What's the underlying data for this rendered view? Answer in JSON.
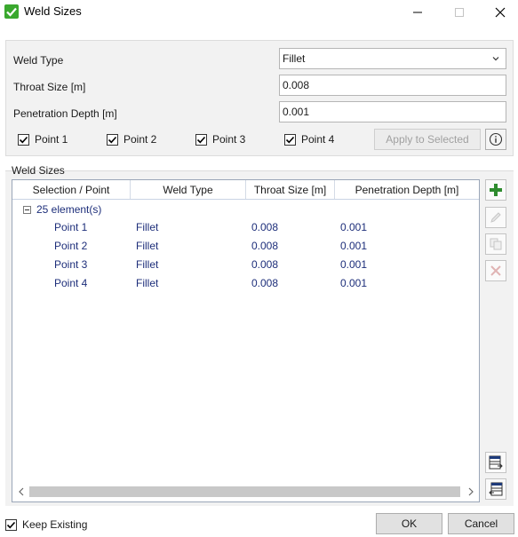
{
  "window": {
    "title": "Weld Sizes",
    "accent": "#3aa82e"
  },
  "form": {
    "weld_type_label": "Weld Type",
    "weld_type_value": "Fillet",
    "throat_label": "Throat Size  [m]",
    "throat_value": "0.008",
    "penetration_label": "Penetration Depth  [m]",
    "penetration_value": "0.001",
    "points": [
      {
        "label": "Point 1",
        "checked": true
      },
      {
        "label": "Point 2",
        "checked": true
      },
      {
        "label": "Point 3",
        "checked": true
      },
      {
        "label": "Point 4",
        "checked": true
      }
    ],
    "apply_label": "Apply to Selected"
  },
  "group": {
    "title": "Weld Sizes"
  },
  "table": {
    "columns": [
      "Selection / Point",
      "Weld Type",
      "Throat Size  [m]",
      "Penetration Depth  [m]"
    ],
    "root_label": "25 element(s)",
    "rows": [
      [
        "Point 1",
        "Fillet",
        "0.008",
        "0.001"
      ],
      [
        "Point 2",
        "Fillet",
        "0.008",
        "0.001"
      ],
      [
        "Point 3",
        "Fillet",
        "0.008",
        "0.001"
      ],
      [
        "Point 4",
        "Fillet",
        "0.008",
        "0.001"
      ]
    ]
  },
  "footer": {
    "keep_existing_label": "Keep Existing",
    "keep_existing_checked": true,
    "ok_label": "OK",
    "cancel_label": "Cancel"
  }
}
